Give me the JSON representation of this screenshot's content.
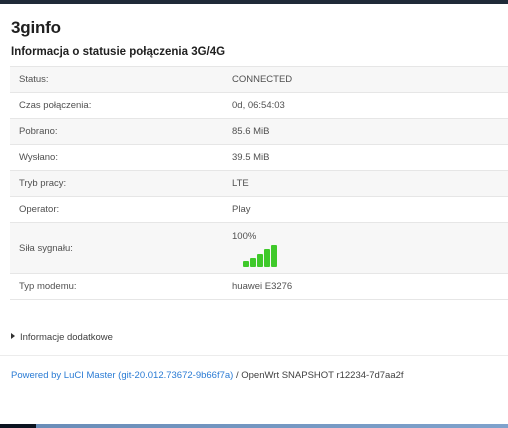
{
  "page": {
    "title": "3ginfo",
    "section_title": "Informacja o statusie połączenia 3G/4G"
  },
  "rows": [
    {
      "label": "Status:",
      "value": "CONNECTED"
    },
    {
      "label": "Czas połączenia:",
      "value": "0d, 06:54:03"
    },
    {
      "label": "Pobrano:",
      "value": "85.6 MiB"
    },
    {
      "label": "Wysłano:",
      "value": "39.5 MiB"
    },
    {
      "label": "Tryb pracy:",
      "value": "LTE"
    },
    {
      "label": "Operator:",
      "value": "Play"
    },
    {
      "label": "Siła sygnału:",
      "value": "100%"
    },
    {
      "label": "Typ modemu:",
      "value": "huawei E3276"
    }
  ],
  "signal": {
    "percent": 100,
    "bars_total": 5,
    "bars_active": 5,
    "color": "#3fc92a"
  },
  "details": {
    "label": "Informacje dodatkowe"
  },
  "footer": {
    "link_text": "Powered by LuCI Master (git-20.012.73672-9b66f7a)",
    "rest_text": " / OpenWrt SNAPSHOT r12234-7d7aa2f"
  },
  "colors": {
    "link": "#2a7bd4",
    "signal": "#3fc92a"
  }
}
